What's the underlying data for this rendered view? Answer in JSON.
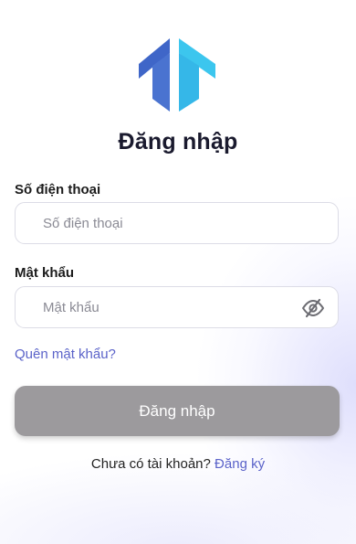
{
  "brand": {
    "logo_icon": "house-t-logo-icon",
    "colors": {
      "logo_dark": "#3f66c8",
      "logo_light": "#3cc6ee"
    }
  },
  "page": {
    "title": "Đăng nhập"
  },
  "form": {
    "phone": {
      "label": "Số điện thoại",
      "value": "",
      "placeholder": "Số điện thoại"
    },
    "password": {
      "label": "Mật khẩu",
      "value": "",
      "placeholder": "Mật khẩu",
      "toggle_icon": "eye-slash-icon"
    },
    "forgot_password": "Quên mật khẩu?",
    "submit_label": "Đăng nhập"
  },
  "signup": {
    "prompt": "Chưa có tài khoản?",
    "link": "Đăng ký"
  },
  "colors": {
    "link": "#5b63c9",
    "button_disabled": "#9c9a9d",
    "title": "#1a1a2e"
  }
}
